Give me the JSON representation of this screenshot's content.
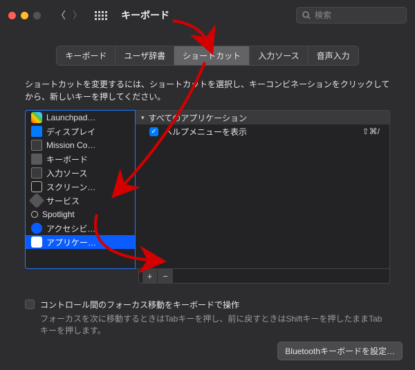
{
  "window": {
    "title": "キーボード",
    "search_placeholder": "検索"
  },
  "tabs": [
    {
      "label": "キーボード",
      "active": false
    },
    {
      "label": "ユーザ辞書",
      "active": false
    },
    {
      "label": "ショートカット",
      "active": true
    },
    {
      "label": "入力ソース",
      "active": false
    },
    {
      "label": "音声入力",
      "active": false
    }
  ],
  "instructions": "ショートカットを変更するには、ショートカットを選択し、キーコンビネーションをクリックしてから、新しいキーを押してください。",
  "categories": [
    {
      "label": "Launchpad…",
      "icon": "ic-launchpad",
      "name": "category-launchpad"
    },
    {
      "label": "ディスプレイ",
      "icon": "ic-display",
      "name": "category-display"
    },
    {
      "label": "Mission Co…",
      "icon": "ic-mission",
      "name": "category-mission-control"
    },
    {
      "label": "キーボード",
      "icon": "ic-keyboard",
      "name": "category-keyboard"
    },
    {
      "label": "入力ソース",
      "icon": "ic-input",
      "name": "category-input-sources"
    },
    {
      "label": "スクリーン…",
      "icon": "ic-screen",
      "name": "category-screenshots"
    },
    {
      "label": "サービス",
      "icon": "ic-services",
      "name": "category-services"
    },
    {
      "label": "Spotlight",
      "icon": "ic-spotlight",
      "name": "category-spotlight"
    },
    {
      "label": "アクセシビ…",
      "icon": "ic-access",
      "name": "category-accessibility"
    },
    {
      "label": "アプリケー…",
      "icon": "ic-app",
      "name": "category-app-shortcuts",
      "selected": true
    }
  ],
  "detail": {
    "group_label": "すべてのアプリケーション",
    "entries": [
      {
        "label": "ヘルプメニューを表示",
        "shortcut": "⇧⌘/",
        "checked": true
      }
    ]
  },
  "buttons": {
    "plus": "+",
    "minus": "−"
  },
  "pref": {
    "label": "コントロール間のフォーカス移動をキーボードで操作",
    "sub": "フォーカスを次に移動するときはTabキーを押し、前に戻すときはShiftキーを押したままTabキーを押します。"
  },
  "bottom": {
    "bluetooth": "Bluetoothキーボードを設定…"
  }
}
